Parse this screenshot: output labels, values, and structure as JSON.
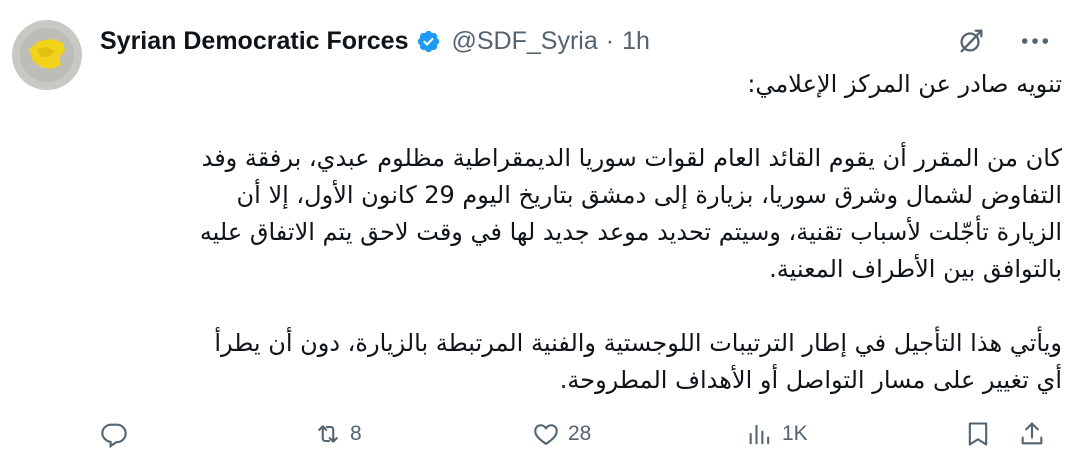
{
  "author": {
    "name": "Syrian Democratic Forces",
    "handle": "@SDF_Syria",
    "separator": "·",
    "time": "1h"
  },
  "tweet": {
    "heading": "تنويه صادر عن المركز الإعلامي:",
    "paragraph1_lines": [
      "كان من المقرر أن يقوم القائد العام لقوات سوريا الديمقراطية مظلوم عبدي، برفقة وفد",
      "التفاوض لشمال وشرق سوريا، بزيارة إلى دمشق بتاريخ اليوم 29 كانون الأول، إلا أن",
      "الزيارة تأجّلت لأسباب تقنية، وسيتم تحديد موعد جديد لها في وقت لاحق يتم الاتفاق عليه",
      "بالتوافق بين الأطراف المعنية."
    ],
    "paragraph2_lines": [
      "ويأتي هذا التأجيل في إطار الترتيبات اللوجستية والفنية المرتبطة بالزيارة، دون أن يطرأ",
      "أي تغيير على مسار التواصل أو الأهداف المطروحة."
    ]
  },
  "actions": {
    "reply_count": "",
    "retweet_count": "8",
    "like_count": "28",
    "views_count": "1K"
  },
  "icons": {
    "verified": "verified-badge-icon",
    "grok": "grok-icon",
    "more": "more-icon",
    "reply": "reply-icon",
    "retweet": "retweet-icon",
    "like": "like-icon",
    "views": "views-icon",
    "bookmark": "bookmark-icon",
    "share": "share-icon"
  },
  "colors": {
    "text": "#0f1419",
    "secondary": "#536471",
    "verified": "#1d9bf0",
    "avatar_bg": "#c9c9c4",
    "flag_yellow": "#f2d21a"
  }
}
